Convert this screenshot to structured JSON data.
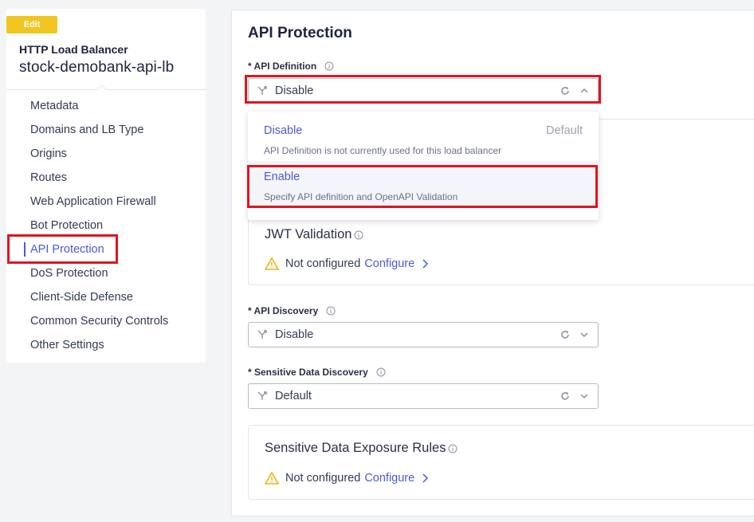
{
  "sidebar": {
    "badge": "Edit",
    "lb_type": "HTTP Load Balancer",
    "lb_name": "stock-demobank-api-lb",
    "items": [
      {
        "label": "Metadata"
      },
      {
        "label": "Domains and LB Type"
      },
      {
        "label": "Origins"
      },
      {
        "label": "Routes"
      },
      {
        "label": "Web Application Firewall"
      },
      {
        "label": "Bot Protection"
      },
      {
        "label": "API Protection"
      },
      {
        "label": "DoS Protection"
      },
      {
        "label": "Client-Side Defense"
      },
      {
        "label": "Common Security Controls"
      },
      {
        "label": "Other Settings"
      }
    ],
    "active_item": "API Protection"
  },
  "main": {
    "title": "API Protection",
    "api_definition": {
      "label": "* API Definition",
      "value": "Disable",
      "options": [
        {
          "label": "Disable",
          "description": "API Definition is not currently used for this load balancer",
          "tag": "Default"
        },
        {
          "label": "Enable",
          "description": "Specify API definition and OpenAPI Validation"
        }
      ]
    },
    "jwt_card": {
      "title": "JWT Validation",
      "status": "Not configured",
      "link": "Configure"
    },
    "api_discovery": {
      "label": "* API Discovery",
      "value": "Disable"
    },
    "sensitive_data_discovery": {
      "label": "* Sensitive Data Discovery",
      "value": "Default"
    },
    "sensitive_card": {
      "title": "Sensitive Data Exposure Rules",
      "status": "Not configured",
      "link": "Configure"
    }
  },
  "colors": {
    "accent": "#4a5ad8",
    "highlight": "#e0141e",
    "badge": "#f3c520",
    "warning": "#f3c520"
  }
}
